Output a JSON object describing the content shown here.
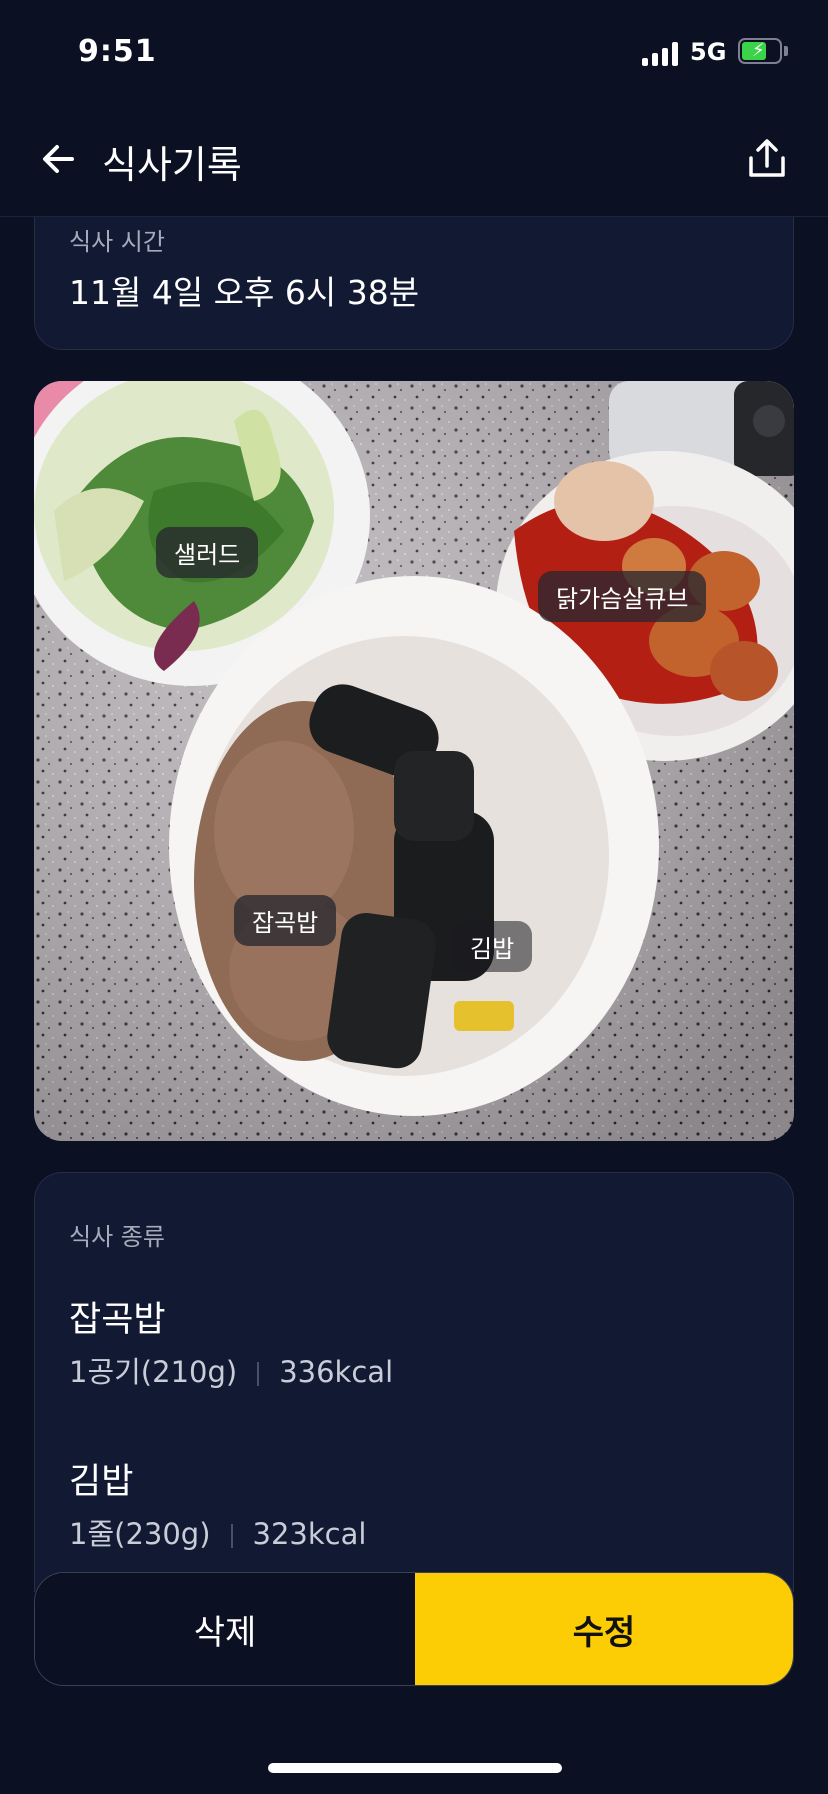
{
  "status_bar": {
    "time": "9:51",
    "network": "5G",
    "battery_color": "#3ad34a"
  },
  "nav": {
    "title": "식사기록",
    "back_icon": "arrow-left-icon",
    "share_icon": "share-icon"
  },
  "meal_time": {
    "label": "식사 시간",
    "value": "11월 4일 오후 6시 38분"
  },
  "photo": {
    "tags": [
      "샐러드",
      "닭가슴살큐브",
      "잡곡밥",
      "김밥"
    ]
  },
  "meal_type": {
    "label": "식사 종류",
    "items": [
      {
        "name": "잡곡밥",
        "portion": "1공기(210g)",
        "calories": "336kcal"
      },
      {
        "name": "김밥",
        "portion": "1줄(230g)",
        "calories": "323kcal"
      }
    ]
  },
  "actions": {
    "delete_label": "삭제",
    "edit_label": "수정",
    "edit_color": "#fccd04"
  }
}
